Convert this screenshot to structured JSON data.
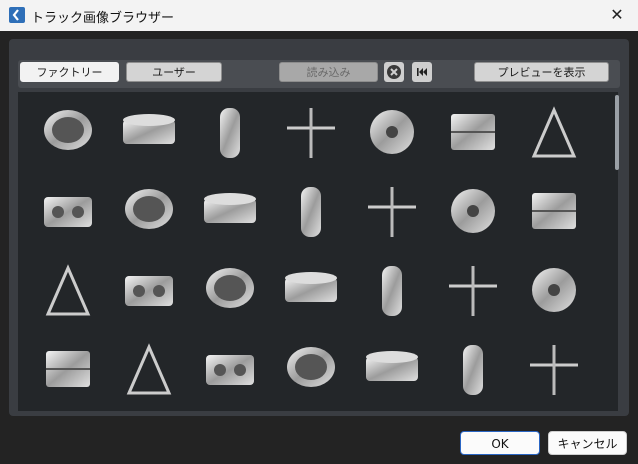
{
  "window": {
    "title": "トラック画像ブラウザー"
  },
  "toolbar": {
    "factory_label": "ファクトリー",
    "user_label": "ユーザー",
    "load_label": "読み込み",
    "preview_label": "プレビューを表示"
  },
  "icons": [
    "bass-drum-icon",
    "marching-snare-icon",
    "snare-drum-icon",
    "hi-hat-icon",
    "cymbal-icon",
    "tom-drum-icon",
    "drum-kit-icon",
    "large-drum-kit-icon",
    "bongos-icon",
    "conga-icon",
    "mridangam-icon",
    "dhol-icon",
    "timbales-icon",
    "gong-icon",
    "djembe-icon",
    "caxixi-icon",
    "tabla-icon",
    "maracas-icon",
    "tambourine-icon",
    "chimes-icon",
    "triangle-icon",
    "electronic-drum-kit-icon",
    "drum-pad-icon",
    "pad-controller-icon",
    "satellite-speaker-icon",
    "marimba-icon",
    "xylophone-icon",
    "guitar-icon"
  ],
  "buttons": {
    "ok": "OK",
    "cancel": "キャンセル"
  },
  "colors": {
    "accent": "#2a66c4",
    "panel": "#3a3d42",
    "grid": "#232629"
  }
}
